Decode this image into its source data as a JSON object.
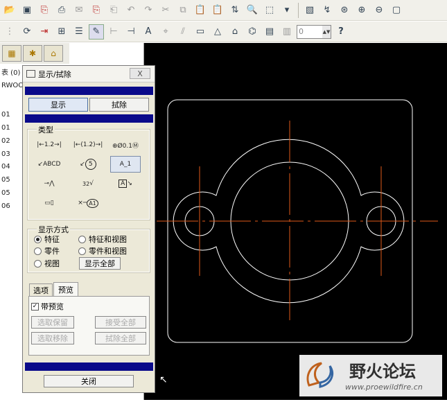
{
  "toolbar2": {
    "zoom_value": "0",
    "help_icon": "?"
  },
  "model_tree": {
    "header_partial": "表 (0)",
    "root_partial": "RWOOD",
    "rows": [
      "01",
      "01",
      "02",
      "03",
      "04",
      "05",
      "05",
      "06"
    ]
  },
  "dialog": {
    "title": "显示/拭除",
    "close_label": "X",
    "show_button": "显示",
    "erase_button": "拭除",
    "type_group": "类型",
    "type_icons": {
      "dim": "1.2",
      "ref_dim": "(1.2)",
      "gtol": "⊕Ø0.1Ⓜ",
      "note": "ABCD",
      "balloon": "5",
      "axis": "A_1",
      "roughness": "32",
      "datum_target": "A",
      "datum_tag": "A1"
    },
    "display_group": "显示方式",
    "display_options": {
      "feature": "特征",
      "feature_and_view": "特征和视图",
      "part": "零件",
      "part_and_view": "零件和视图",
      "view": "视图"
    },
    "show_all_button": "显示全部",
    "tabs": [
      "选项",
      "预览"
    ],
    "with_preview": "带预览",
    "select_keep": "选取保留",
    "accept_all": "接受全部",
    "select_remove": "选取移除",
    "erase_all": "拭除全部",
    "close_button": "关闭"
  },
  "watermark": {
    "title": "野火论坛",
    "url": "www.proewildfire.cn"
  },
  "colors": {
    "accent_bar": "#0a0a8a",
    "drawing_lines": "#ffffff",
    "center_lines": "#e05a1a",
    "canvas_bg": "#000000"
  }
}
